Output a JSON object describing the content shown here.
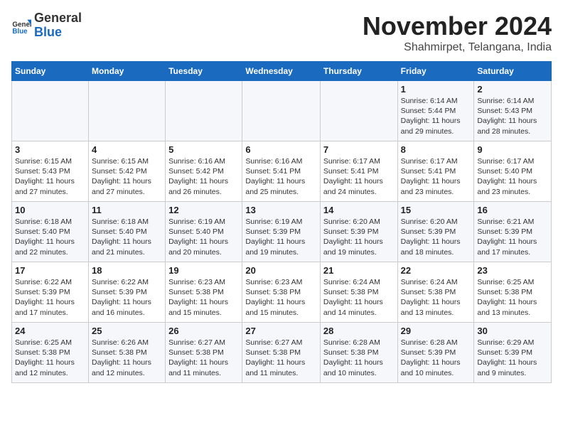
{
  "logo": {
    "general": "General",
    "blue": "Blue"
  },
  "title": "November 2024",
  "location": "Shahmirpet, Telangana, India",
  "days_of_week": [
    "Sunday",
    "Monday",
    "Tuesday",
    "Wednesday",
    "Thursday",
    "Friday",
    "Saturday"
  ],
  "weeks": [
    [
      {
        "day": "",
        "detail": ""
      },
      {
        "day": "",
        "detail": ""
      },
      {
        "day": "",
        "detail": ""
      },
      {
        "day": "",
        "detail": ""
      },
      {
        "day": "",
        "detail": ""
      },
      {
        "day": "1",
        "detail": "Sunrise: 6:14 AM\nSunset: 5:44 PM\nDaylight: 11 hours and 29 minutes."
      },
      {
        "day": "2",
        "detail": "Sunrise: 6:14 AM\nSunset: 5:43 PM\nDaylight: 11 hours and 28 minutes."
      }
    ],
    [
      {
        "day": "3",
        "detail": "Sunrise: 6:15 AM\nSunset: 5:43 PM\nDaylight: 11 hours and 27 minutes."
      },
      {
        "day": "4",
        "detail": "Sunrise: 6:15 AM\nSunset: 5:42 PM\nDaylight: 11 hours and 27 minutes."
      },
      {
        "day": "5",
        "detail": "Sunrise: 6:16 AM\nSunset: 5:42 PM\nDaylight: 11 hours and 26 minutes."
      },
      {
        "day": "6",
        "detail": "Sunrise: 6:16 AM\nSunset: 5:41 PM\nDaylight: 11 hours and 25 minutes."
      },
      {
        "day": "7",
        "detail": "Sunrise: 6:17 AM\nSunset: 5:41 PM\nDaylight: 11 hours and 24 minutes."
      },
      {
        "day": "8",
        "detail": "Sunrise: 6:17 AM\nSunset: 5:41 PM\nDaylight: 11 hours and 23 minutes."
      },
      {
        "day": "9",
        "detail": "Sunrise: 6:17 AM\nSunset: 5:40 PM\nDaylight: 11 hours and 23 minutes."
      }
    ],
    [
      {
        "day": "10",
        "detail": "Sunrise: 6:18 AM\nSunset: 5:40 PM\nDaylight: 11 hours and 22 minutes."
      },
      {
        "day": "11",
        "detail": "Sunrise: 6:18 AM\nSunset: 5:40 PM\nDaylight: 11 hours and 21 minutes."
      },
      {
        "day": "12",
        "detail": "Sunrise: 6:19 AM\nSunset: 5:40 PM\nDaylight: 11 hours and 20 minutes."
      },
      {
        "day": "13",
        "detail": "Sunrise: 6:19 AM\nSunset: 5:39 PM\nDaylight: 11 hours and 19 minutes."
      },
      {
        "day": "14",
        "detail": "Sunrise: 6:20 AM\nSunset: 5:39 PM\nDaylight: 11 hours and 19 minutes."
      },
      {
        "day": "15",
        "detail": "Sunrise: 6:20 AM\nSunset: 5:39 PM\nDaylight: 11 hours and 18 minutes."
      },
      {
        "day": "16",
        "detail": "Sunrise: 6:21 AM\nSunset: 5:39 PM\nDaylight: 11 hours and 17 minutes."
      }
    ],
    [
      {
        "day": "17",
        "detail": "Sunrise: 6:22 AM\nSunset: 5:39 PM\nDaylight: 11 hours and 17 minutes."
      },
      {
        "day": "18",
        "detail": "Sunrise: 6:22 AM\nSunset: 5:39 PM\nDaylight: 11 hours and 16 minutes."
      },
      {
        "day": "19",
        "detail": "Sunrise: 6:23 AM\nSunset: 5:38 PM\nDaylight: 11 hours and 15 minutes."
      },
      {
        "day": "20",
        "detail": "Sunrise: 6:23 AM\nSunset: 5:38 PM\nDaylight: 11 hours and 15 minutes."
      },
      {
        "day": "21",
        "detail": "Sunrise: 6:24 AM\nSunset: 5:38 PM\nDaylight: 11 hours and 14 minutes."
      },
      {
        "day": "22",
        "detail": "Sunrise: 6:24 AM\nSunset: 5:38 PM\nDaylight: 11 hours and 13 minutes."
      },
      {
        "day": "23",
        "detail": "Sunrise: 6:25 AM\nSunset: 5:38 PM\nDaylight: 11 hours and 13 minutes."
      }
    ],
    [
      {
        "day": "24",
        "detail": "Sunrise: 6:25 AM\nSunset: 5:38 PM\nDaylight: 11 hours and 12 minutes."
      },
      {
        "day": "25",
        "detail": "Sunrise: 6:26 AM\nSunset: 5:38 PM\nDaylight: 11 hours and 12 minutes."
      },
      {
        "day": "26",
        "detail": "Sunrise: 6:27 AM\nSunset: 5:38 PM\nDaylight: 11 hours and 11 minutes."
      },
      {
        "day": "27",
        "detail": "Sunrise: 6:27 AM\nSunset: 5:38 PM\nDaylight: 11 hours and 11 minutes."
      },
      {
        "day": "28",
        "detail": "Sunrise: 6:28 AM\nSunset: 5:38 PM\nDaylight: 11 hours and 10 minutes."
      },
      {
        "day": "29",
        "detail": "Sunrise: 6:28 AM\nSunset: 5:39 PM\nDaylight: 11 hours and 10 minutes."
      },
      {
        "day": "30",
        "detail": "Sunrise: 6:29 AM\nSunset: 5:39 PM\nDaylight: 11 hours and 9 minutes."
      }
    ]
  ]
}
